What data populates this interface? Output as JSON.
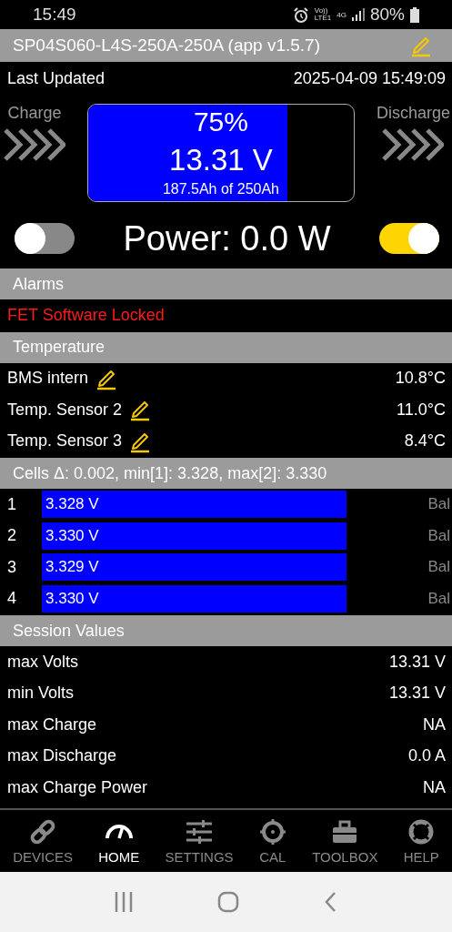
{
  "status_bar": {
    "time": "15:49",
    "network_top": "Vo))",
    "network_bottom": "LTE1",
    "data": "4G",
    "battery": "80%"
  },
  "title_bar": {
    "title": "SP04S060-L4S-250A-250A (app v1.5.7)"
  },
  "last_updated": {
    "label": "Last Updated",
    "value": "2025-04-09 15:49:09"
  },
  "gauge": {
    "charge_label": "Charge",
    "discharge_label": "Discharge",
    "percent": "75%",
    "voltage": "13.31 V",
    "capacity": "187.5Ah of 250Ah",
    "level": 0.75
  },
  "power": {
    "charge_switch_on": false,
    "text": "Power: 0.0 W",
    "discharge_switch_on": true
  },
  "alarms": {
    "header": "Alarms",
    "items": [
      "FET Software Locked"
    ]
  },
  "temperature": {
    "header": "Temperature",
    "sensors": [
      {
        "name": "BMS intern",
        "value": "10.8°C"
      },
      {
        "name": "Temp. Sensor 2",
        "value": "11.0°C"
      },
      {
        "name": "Temp. Sensor 3",
        "value": "8.4°C"
      }
    ]
  },
  "cells": {
    "header": "Cells Δ: 0.002, min[1]: 3.328, max[2]: 3.330",
    "items": [
      {
        "index": "1",
        "voltage": "3.328 V",
        "balance": "Bal",
        "balancing": false
      },
      {
        "index": "2",
        "voltage": "3.330 V",
        "balance": "Bal",
        "balancing": false
      },
      {
        "index": "3",
        "voltage": "3.329 V",
        "balance": "Bal",
        "balancing": false
      },
      {
        "index": "4",
        "voltage": "3.330 V",
        "balance": "Bal",
        "balancing": false
      }
    ]
  },
  "session": {
    "header": "Session Values",
    "rows": [
      {
        "label": "max Volts",
        "value": "13.31 V"
      },
      {
        "label": "min Volts",
        "value": "13.31 V"
      },
      {
        "label": "max Charge",
        "value": "NA"
      },
      {
        "label": "max Discharge",
        "value": "0.0 A"
      },
      {
        "label": "max Charge Power",
        "value": "NA"
      }
    ]
  },
  "bottom_nav": [
    {
      "kind": "link",
      "label": "DEVICES",
      "selected": false
    },
    {
      "kind": "gauge",
      "label": "HOME",
      "selected": true
    },
    {
      "kind": "sliders",
      "label": "SETTINGS",
      "selected": false
    },
    {
      "kind": "crosshair",
      "label": "CAL",
      "selected": false
    },
    {
      "kind": "toolbox",
      "label": "TOOLBOX",
      "selected": false
    },
    {
      "kind": "lifebuoy",
      "label": "HELP",
      "selected": false
    }
  ]
}
